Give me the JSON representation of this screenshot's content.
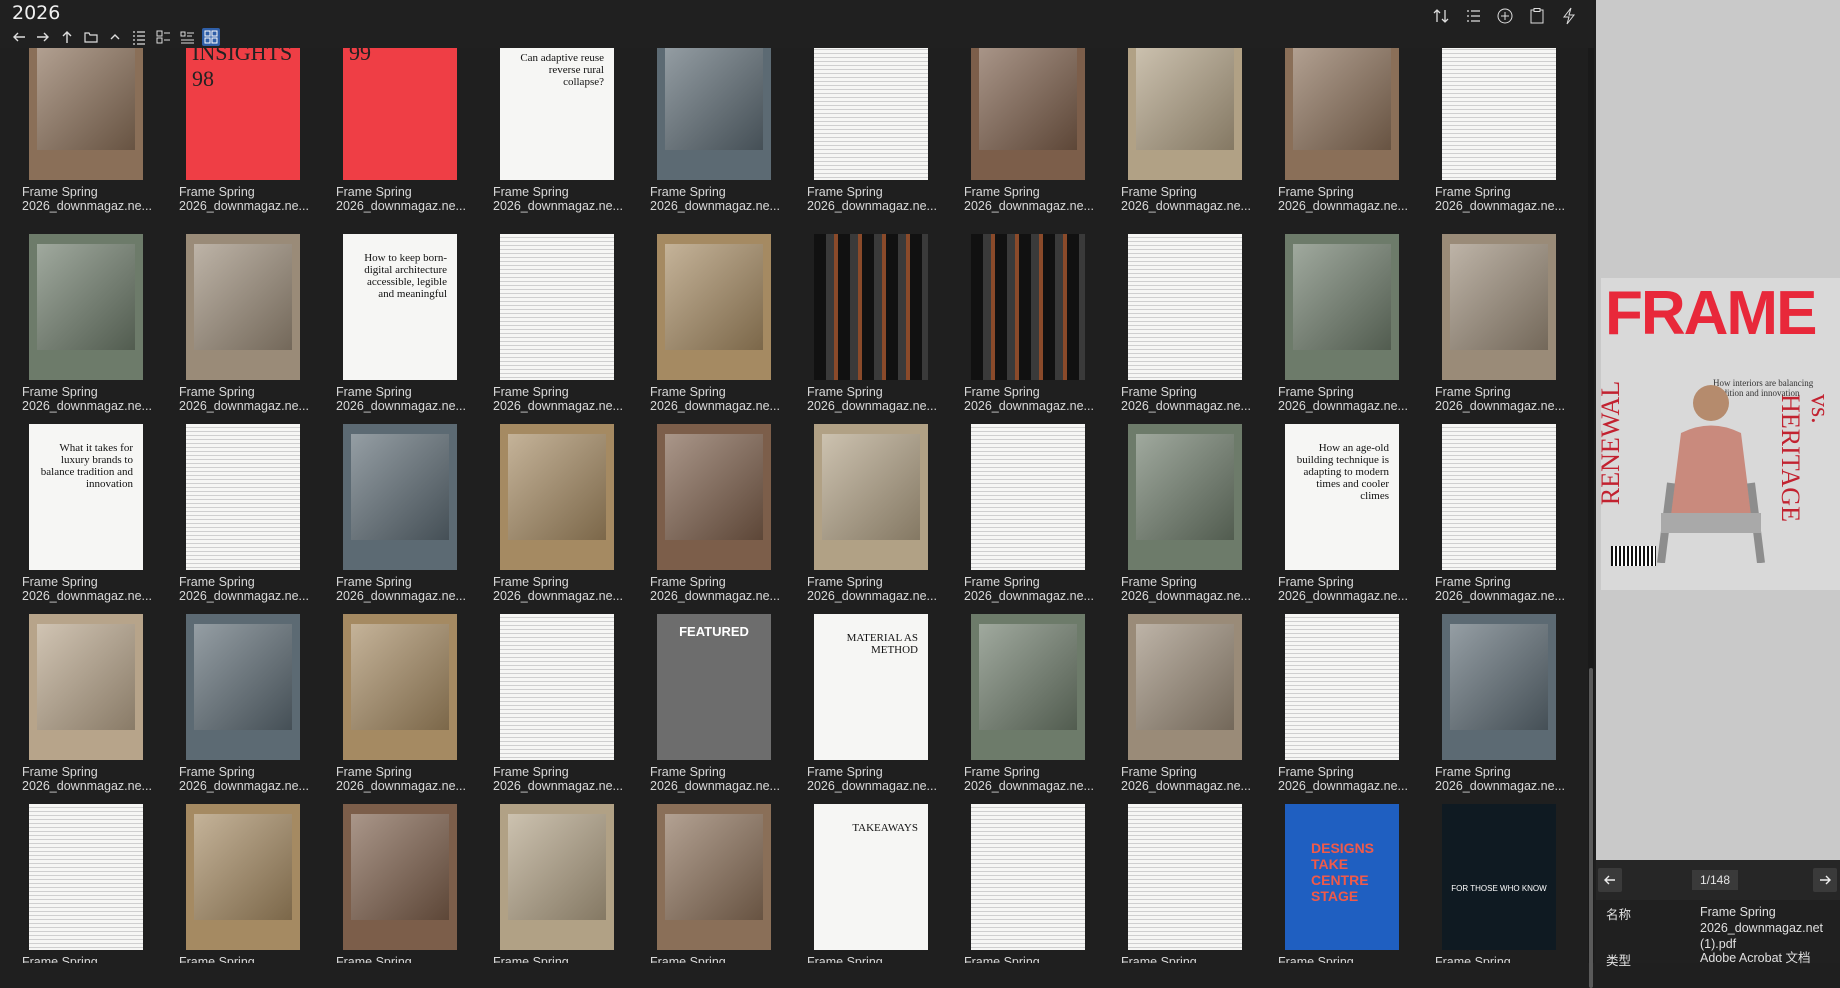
{
  "window": {
    "title": "2026"
  },
  "toolbar": {
    "nav_icons": [
      "arrow-left-icon",
      "arrow-right-icon",
      "arrow-up-icon",
      "folder-icon",
      "chevron-up-icon",
      "list-view-icon",
      "detail-view-icon",
      "compact-view-icon",
      "grid-view-icon"
    ],
    "right_icons": [
      "sort-icon",
      "list-icon",
      "add-circle-icon",
      "clipboard-icon",
      "lightning-icon"
    ]
  },
  "files": {
    "caption_line1": "Frame Spring",
    "caption_line2": "2026_downmagaz.ne...",
    "rows": [
      [
        {
          "style": "photo",
          "text": ""
        },
        {
          "style": "red",
          "text": "INSIGHTS\n98"
        },
        {
          "style": "red",
          "text": "99"
        },
        {
          "style": "serif",
          "text": "Can adaptive reuse reverse rural collapse?"
        },
        {
          "style": "photo",
          "text": ""
        },
        {
          "style": "text",
          "text": ""
        },
        {
          "style": "photo",
          "text": ""
        },
        {
          "style": "photo",
          "text": ""
        },
        {
          "style": "photo",
          "text": ""
        },
        {
          "style": "text",
          "text": ""
        }
      ],
      [
        {
          "style": "photo",
          "text": ""
        },
        {
          "style": "photo",
          "text": ""
        },
        {
          "style": "serif",
          "text": "How to keep born-digital architecture accessible, legible and meaningful"
        },
        {
          "style": "text",
          "text": ""
        },
        {
          "style": "photo",
          "text": ""
        },
        {
          "style": "dark",
          "text": ""
        },
        {
          "style": "dark",
          "text": ""
        },
        {
          "style": "text",
          "text": ""
        },
        {
          "style": "photo",
          "text": ""
        },
        {
          "style": "photo",
          "text": ""
        }
      ],
      [
        {
          "style": "serif",
          "text": "What it takes for luxury brands to balance tradition and innovation"
        },
        {
          "style": "text",
          "text": ""
        },
        {
          "style": "photo",
          "text": ""
        },
        {
          "style": "photo",
          "text": ""
        },
        {
          "style": "photo",
          "text": ""
        },
        {
          "style": "photo",
          "text": ""
        },
        {
          "style": "text",
          "text": ""
        },
        {
          "style": "photo",
          "text": ""
        },
        {
          "style": "serif",
          "text": "How an age-old building technique is adapting to modern times and cooler climes"
        },
        {
          "style": "text",
          "text": ""
        }
      ],
      [
        {
          "style": "photo",
          "text": ""
        },
        {
          "style": "photo",
          "text": ""
        },
        {
          "style": "photo",
          "text": ""
        },
        {
          "style": "text",
          "text": ""
        },
        {
          "style": "grey",
          "text": "FEATURED"
        },
        {
          "style": "serif",
          "text": "MATERIAL AS METHOD"
        },
        {
          "style": "photo",
          "text": ""
        },
        {
          "style": "photo",
          "text": ""
        },
        {
          "style": "text",
          "text": ""
        },
        {
          "style": "photo",
          "text": ""
        }
      ],
      [
        {
          "style": "text",
          "text": ""
        },
        {
          "style": "photo",
          "text": ""
        },
        {
          "style": "photo",
          "text": ""
        },
        {
          "style": "photo",
          "text": ""
        },
        {
          "style": "photo",
          "text": ""
        },
        {
          "style": "serif",
          "text": "TAKEAWAYS"
        },
        {
          "style": "text",
          "text": ""
        },
        {
          "style": "text",
          "text": ""
        },
        {
          "style": "blue",
          "text": "DESIGNS TAKE CENTRE STAGE"
        },
        {
          "style": "ad",
          "text": "FOR THOSE WHO KNOW"
        }
      ]
    ]
  },
  "preview": {
    "cover_masthead": "FRAME",
    "cover_left_word": "RENEWAL",
    "cover_right_word": "vs. HERITAGE",
    "cover_tagline": "How interiors are balancing tradition and innovation",
    "page_indicator": "1/148",
    "meta": {
      "name_label": "名称",
      "name_value": "Frame Spring 2026_downmagaz.net (1).pdf",
      "type_label": "类型",
      "type_value": "Adobe Acrobat 文档"
    }
  },
  "colors": {
    "accent": "#2f5fa8",
    "red": "#e8283a",
    "panel": "#1f1f1f"
  }
}
